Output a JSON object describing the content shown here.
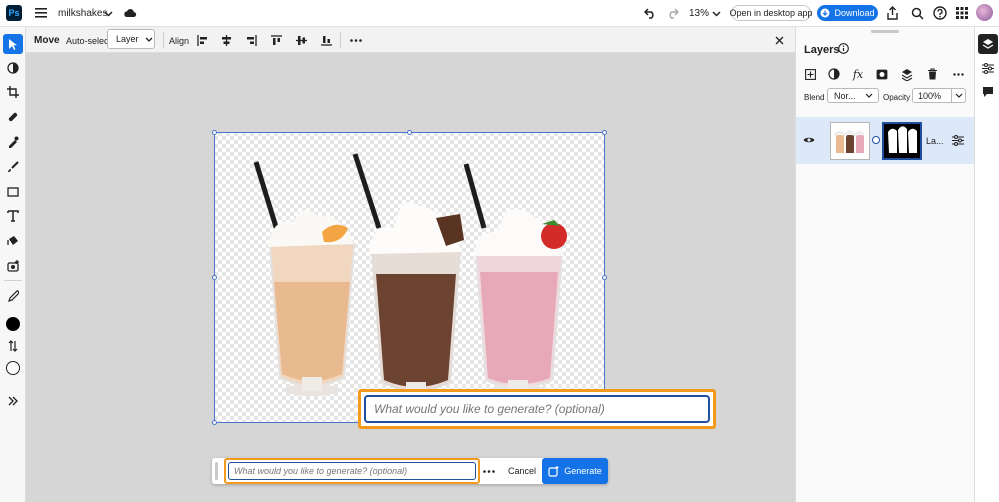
{
  "app": {
    "logo_text": "Ps",
    "doc_title": "milkshakes"
  },
  "topbar": {
    "zoom": "13%",
    "open_desktop_label": "Open in desktop app",
    "download_label": "Download",
    "accent": "#1473e6"
  },
  "options": {
    "tool_label": "Move",
    "autoselect_label": "Auto-select",
    "layer_select_value": "Layer",
    "align_label": "Align"
  },
  "prompt_large": {
    "placeholder": "What would you like to generate? (optional)"
  },
  "taskbar": {
    "placeholder": "What would you like to generate? (optional)",
    "cancel_label": "Cancel",
    "generate_label": "Generate"
  },
  "layers_panel": {
    "title": "Layers",
    "blend_label": "Blend",
    "blend_value": "Nor...",
    "opacity_label": "Opacity",
    "opacity_value": "100%",
    "layer_name": "La..."
  },
  "highlight_color": "#f29a1c"
}
